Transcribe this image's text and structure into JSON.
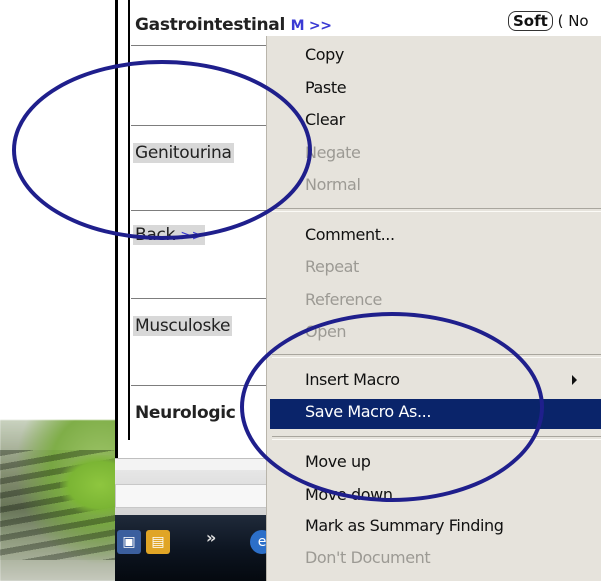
{
  "form": {
    "rows": [
      {
        "label": "Gastrointestinal",
        "link": "M >>",
        "bold": true
      },
      {
        "label": "Genitourina",
        "bold": false
      },
      {
        "label": "Back",
        "link": ">>",
        "bold": false
      },
      {
        "label": "Musculoske",
        "bold": false
      },
      {
        "label": "Neurologic",
        "bold": true
      }
    ],
    "soft_label": "Soft",
    "soft_suffix": "( No"
  },
  "context_menu": {
    "items": [
      {
        "label": "Copy",
        "enabled": true
      },
      {
        "label": "Paste",
        "enabled": true
      },
      {
        "label": "Clear",
        "enabled": true
      },
      {
        "label": "Negate",
        "enabled": false
      },
      {
        "label": "Normal",
        "enabled": false
      },
      {
        "label": "Comment...",
        "enabled": true
      },
      {
        "label": "Repeat",
        "enabled": false
      },
      {
        "label": "Reference",
        "enabled": false
      },
      {
        "label": "Open",
        "enabled": false
      },
      {
        "label": "Insert Macro",
        "enabled": true,
        "submenu": true
      },
      {
        "label": "Save Macro As...",
        "enabled": true,
        "selected": true
      },
      {
        "label": "Move up",
        "enabled": true
      },
      {
        "label": "Move down",
        "enabled": true
      },
      {
        "label": "Mark as Summary Finding",
        "enabled": true
      },
      {
        "label": "Don't Document",
        "enabled": false
      }
    ]
  },
  "taskbar": {
    "chevron": "»"
  },
  "colors": {
    "annotation_oval": "#1f1f8c",
    "menu_highlight": "#0a246a",
    "menu_background": "#e6e3dc"
  }
}
